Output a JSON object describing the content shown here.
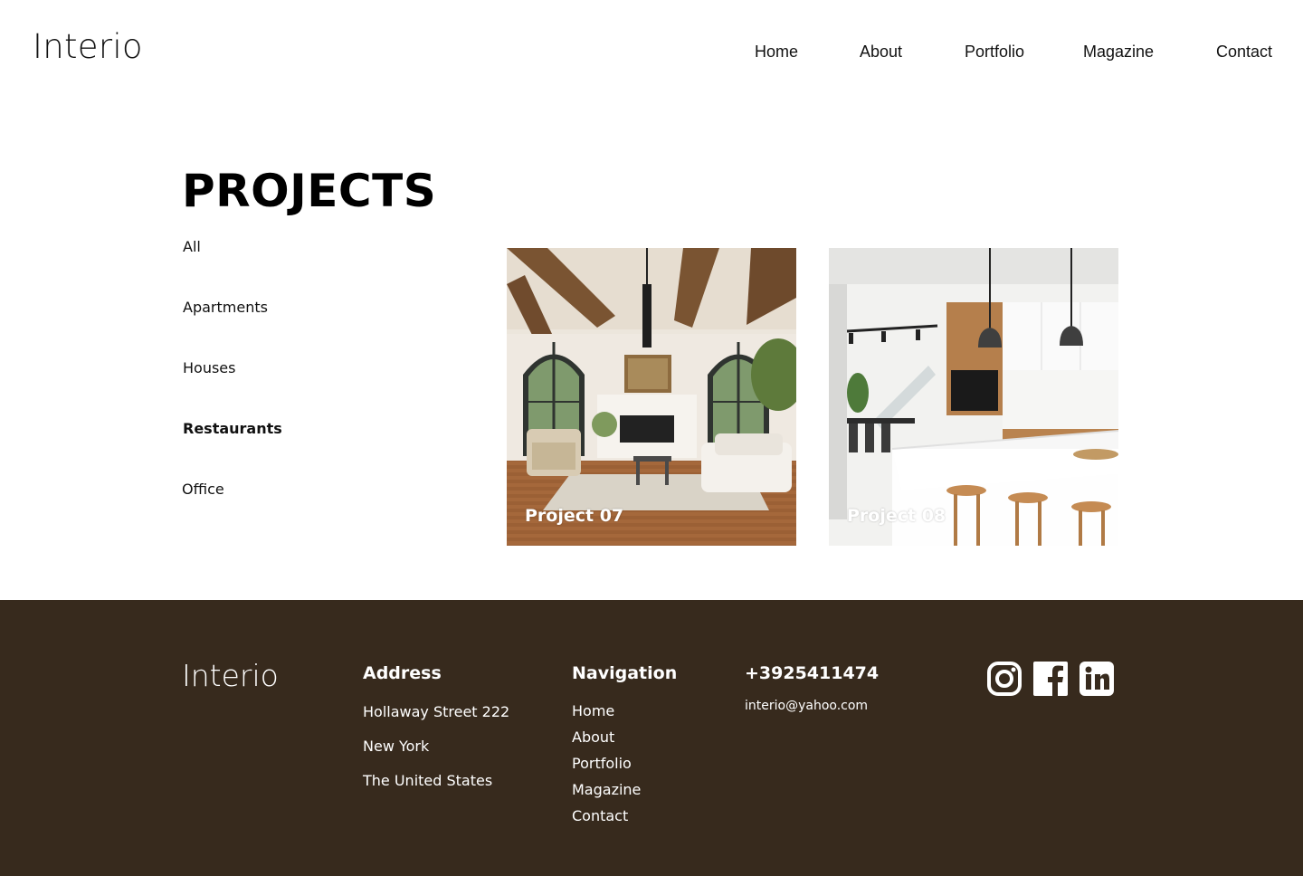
{
  "header": {
    "logo": "Interio",
    "nav": [
      "Home",
      "About",
      "Portfolio",
      "Magazine",
      "Contact"
    ]
  },
  "projects": {
    "title": "PROJECTS",
    "filters": [
      {
        "label": "All",
        "active": false
      },
      {
        "label": "Apartments",
        "active": false
      },
      {
        "label": "Houses",
        "active": false
      },
      {
        "label": "Restaurants",
        "active": true
      },
      {
        "label": "Office",
        "active": false
      }
    ],
    "cards": [
      {
        "label": "Project 07"
      },
      {
        "label": "Project 08"
      }
    ]
  },
  "footer": {
    "logo": "Interio",
    "address": {
      "heading": "Address",
      "lines": [
        "Hollaway Street 222",
        "New York",
        "The United States"
      ]
    },
    "navigation": {
      "heading": "Navigation",
      "links": [
        "Home",
        "About",
        "Portfolio",
        "Magazine",
        "Contact"
      ]
    },
    "contact": {
      "phone": "+3925411474",
      "email": "interio@yahoo.com"
    },
    "social": [
      "instagram-icon",
      "facebook-icon",
      "linkedin-icon"
    ],
    "background_color": "#372a1d"
  }
}
